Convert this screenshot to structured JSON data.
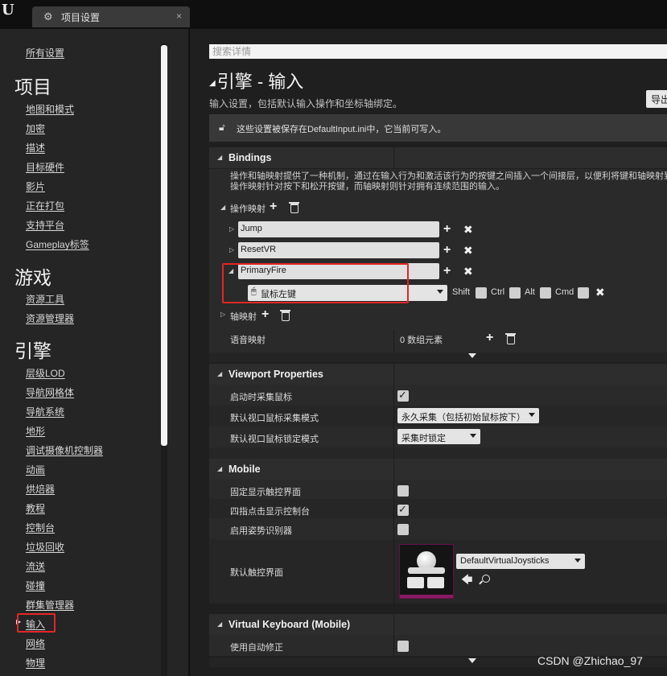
{
  "window": {
    "logo": "U",
    "tab_title": "项目设置",
    "tab_close": "×"
  },
  "sidebar": {
    "items": [
      {
        "label": "所有设置"
      },
      {
        "category": "项目"
      },
      {
        "label": "地图和模式"
      },
      {
        "label": "加密"
      },
      {
        "label": "描述"
      },
      {
        "label": "目标硬件"
      },
      {
        "label": "影片"
      },
      {
        "label": "正在打包"
      },
      {
        "label": "支持平台"
      },
      {
        "label": "Gameplay标签"
      },
      {
        "category": "游戏"
      },
      {
        "label": "资源工具"
      },
      {
        "label": "资源管理器"
      },
      {
        "category": "引擎"
      },
      {
        "label": "层级LOD"
      },
      {
        "label": "导航网格体"
      },
      {
        "label": "导航系统"
      },
      {
        "label": "地形"
      },
      {
        "label": "调试摄像机控制器"
      },
      {
        "label": "动画"
      },
      {
        "label": "烘焙器"
      },
      {
        "label": "教程"
      },
      {
        "label": "控制台"
      },
      {
        "label": "垃圾回收"
      },
      {
        "label": "流送"
      },
      {
        "label": "碰撞"
      },
      {
        "label": "群集管理器"
      },
      {
        "label": "输入",
        "selected": true
      },
      {
        "label": "网络"
      },
      {
        "label": "物理"
      }
    ]
  },
  "main": {
    "search_placeholder": "搜索详情",
    "title": "引擎 - 输入",
    "description": "输入设置，包括默认输入操作和坐标轴绑定。",
    "export_label": "导出",
    "notice": "这些设置被保存在DefaultInput.ini中，它当前可写入。",
    "bindings": {
      "section_title": "Bindings",
      "description_line1": "操作和轴映射提供了一种机制，通过在输入行为和激活该行为的按键之间插入一个间接层，以便利将键和轴映射到",
      "description_line2": "操作映射针对按下和松开按键，而轴映射则针对拥有连续范围的输入。",
      "action_mappings_label": "操作映射",
      "actions": [
        {
          "name": "Jump"
        },
        {
          "name": "ResetVR"
        },
        {
          "name": "PrimaryFire"
        }
      ],
      "primary_fire_key": "鼠标左键",
      "modifiers": [
        "Shift",
        "Ctrl",
        "Alt",
        "Cmd"
      ],
      "axis_mappings_label": "轴映射",
      "speech_mappings_label": "语音映射",
      "speech_mappings_value": "0 数组元素"
    },
    "viewport": {
      "section_title": "Viewport Properties",
      "rows": [
        {
          "label": "启动时采集鼠标",
          "checked": true
        },
        {
          "label": "默认视口鼠标采集模式",
          "value": "永久采集（包括初始鼠标按下）"
        },
        {
          "label": "默认视口鼠标锁定模式",
          "value": "采集时锁定"
        }
      ]
    },
    "mobile": {
      "section_title": "Mobile",
      "rows": [
        {
          "label": "固定显示触控界面",
          "checked": false
        },
        {
          "label": "四指点击显示控制台",
          "checked": true
        },
        {
          "label": "启用姿势识别器",
          "checked": false
        }
      ],
      "default_touch_label": "默认触控界面",
      "default_touch_value": "DefaultVirtualJoysticks"
    },
    "virtual_keyboard": {
      "section_title": "Virtual Keyboard (Mobile)",
      "rows": [
        {
          "label": "使用自动修正",
          "checked": false
        }
      ]
    }
  },
  "watermark": "CSDN @Zhichao_97",
  "colors": {
    "highlight_box": "#e32626",
    "background": "#1f1f1f",
    "panel": "#2a2a2a",
    "section_header": "#2d2d2d"
  }
}
